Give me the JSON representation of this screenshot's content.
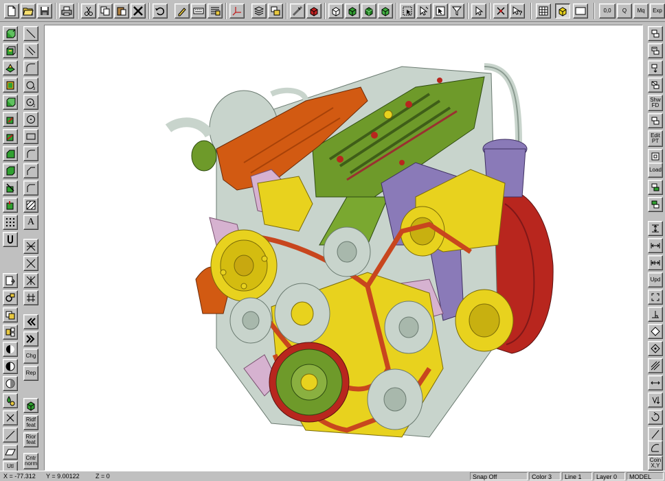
{
  "toolbar": {
    "zero_label": "0,0",
    "q_label": "Q",
    "mq_label": "Mq",
    "exp_label": "Exp"
  },
  "left_palette": {
    "chg_label": "Chg",
    "rep_label": "Rep",
    "ridf_label": "Ridf feat",
    "rior_label": "Rior feat",
    "cntr_label": "Cntr norm",
    "utl_label": "Utl",
    "text_tool_label": "A"
  },
  "right_palette": {
    "shw_label": "Shw FD",
    "edit_label": "Edit PT",
    "load_label": "Load",
    "upd_label": "Upd",
    "coin_label": "Coin X,Y"
  },
  "status": {
    "x": "X = -77.312",
    "y": "Y = 9.00122",
    "z": "Z = 0",
    "snap": "Snap Off",
    "color": "Color 3",
    "line": "Line 1",
    "layer": "Layer 0",
    "mode": "MODEL"
  },
  "colors": {
    "engine_green": "#6e9a2a",
    "engine_orange": "#d25a12",
    "engine_yellow": "#e8d21e",
    "engine_red": "#b8261e",
    "engine_purple": "#8a7ab8",
    "engine_pink": "#d6b2d0",
    "engine_grey": "#c8d4cc"
  }
}
